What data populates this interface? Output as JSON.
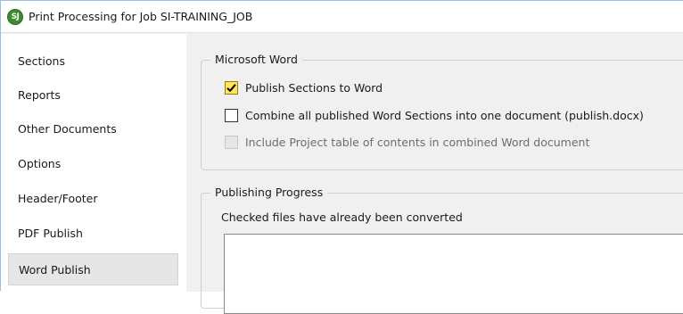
{
  "window": {
    "title": "Print Processing for Job SI-TRAINING_JOB",
    "icon_text": "SJ",
    "icon_color": "#3f8a30"
  },
  "sidebar": {
    "items": [
      {
        "label": "Sections"
      },
      {
        "label": "Reports"
      },
      {
        "label": "Other Documents"
      },
      {
        "label": "Options"
      },
      {
        "label": "Header/Footer"
      },
      {
        "label": "PDF Publish"
      },
      {
        "label": "Word Publish",
        "selected": true
      }
    ]
  },
  "word_group": {
    "legend": "Microsoft Word",
    "options": [
      {
        "label": "Publish Sections to Word",
        "checked": true,
        "enabled": true
      },
      {
        "label": "Combine all published Word Sections into one document (publish.docx)",
        "checked": false,
        "enabled": true
      },
      {
        "label": "Include Project table of contents in combined Word document",
        "checked": false,
        "enabled": false
      }
    ]
  },
  "progress_group": {
    "legend": "Publishing Progress",
    "hint": "Checked files have already been converted",
    "files": []
  }
}
